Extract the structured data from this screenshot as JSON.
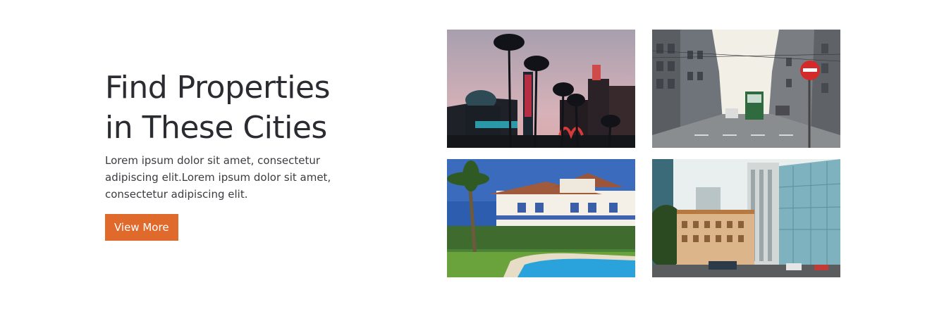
{
  "section": {
    "title_line1": "Find Properties",
    "title_line2": "in These Cities",
    "description": "Lorem ipsum dolor sit amet, consectetur adipiscing elit.Lorem ipsum dolor sit amet, consectetur adipiscing elit.",
    "button_label": "View More"
  },
  "colors": {
    "accent": "#e0692c",
    "heading": "#2a2c31",
    "body_text": "#3a3c40",
    "background": "#ffffff"
  },
  "gallery": [
    {
      "name": "palm-trees-neon-city-photo"
    },
    {
      "name": "city-street-tram-photo"
    },
    {
      "name": "villa-pool-photo"
    },
    {
      "name": "downtown-skyscrapers-photo"
    }
  ]
}
